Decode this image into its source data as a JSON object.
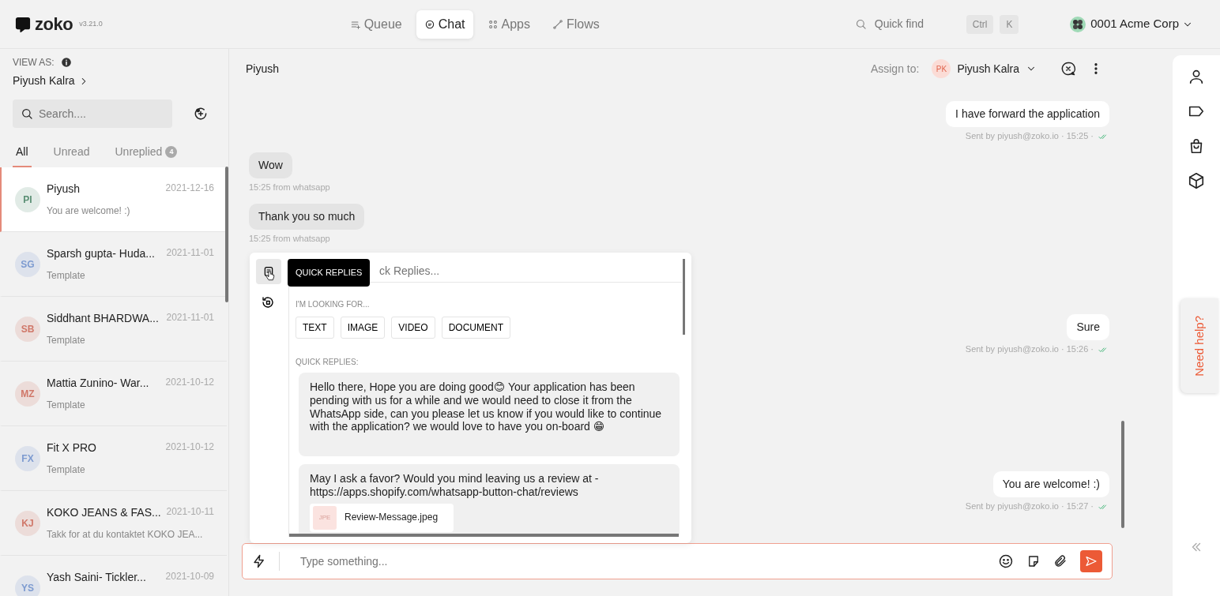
{
  "app": {
    "logo": "zoko",
    "version": "v3.21.0"
  },
  "nav": [
    {
      "label": "Queue",
      "selected": false
    },
    {
      "label": "Chat",
      "selected": true
    },
    {
      "label": "Apps",
      "selected": false
    },
    {
      "label": "Flows",
      "selected": false
    }
  ],
  "quick_find": {
    "placeholder": "Quick find",
    "keys": [
      "Ctrl",
      "K"
    ]
  },
  "account": {
    "name": "0001 Acme Corp"
  },
  "sidebar": {
    "view_as_label": "VIEW AS:",
    "view_as_user": "Piyush Kalra",
    "search_placeholder": "Search....",
    "tabs": [
      {
        "label": "All",
        "selected": true
      },
      {
        "label": "Unread",
        "selected": false
      },
      {
        "label": "Unreplied",
        "count": "4",
        "selected": false
      }
    ],
    "chats": [
      {
        "initials": "PI",
        "name": "Piyush",
        "date": "2021-12-16",
        "preview": "You are welcome! :)",
        "color": "#5a8f74",
        "selected": true
      },
      {
        "initials": "SG",
        "name": "Sparsh gupta- Huda...",
        "date": "2021-11-01",
        "preview": "Template",
        "color": "#7d9bd0",
        "selected": false
      },
      {
        "initials": "SB",
        "name": "Siddhant BHARDWA...",
        "date": "2021-11-01",
        "preview": "Template",
        "color": "#d0786a",
        "selected": false
      },
      {
        "initials": "MZ",
        "name": "Mattia Zunino- War...",
        "date": "2021-10-12",
        "preview": "Template",
        "color": "#d0786a",
        "selected": false
      },
      {
        "initials": "FX",
        "name": "Fit X PRO",
        "date": "2021-10-12",
        "preview": "Template",
        "color": "#7d9bd0",
        "selected": false
      },
      {
        "initials": "KJ",
        "name": "KOKO JEANS & FAS...",
        "date": "2021-10-11",
        "preview": "Takk for at du kontaktet KOKO JEA...",
        "color": "#d0786a",
        "selected": false
      },
      {
        "initials": "YS",
        "name": "Yash Saini- Tickler...",
        "date": "2021-10-09",
        "color": "#7d9bd0",
        "selected": false
      }
    ]
  },
  "chat": {
    "title": "Piyush",
    "assign_label": "Assign to:",
    "assignee": {
      "initials": "PK",
      "name": "Piyush Kalra"
    },
    "messages": [
      {
        "kind": "outgoing",
        "text": "I have forward the application",
        "meta": "Sent by piyush@zoko.io · 15:25 ·",
        "read": true
      },
      {
        "kind": "incoming",
        "text": "Wow",
        "meta": "15:25 from whatsapp"
      },
      {
        "kind": "incoming",
        "text": "Thank you so much",
        "meta": "15:25 from whatsapp"
      },
      {
        "kind": "outgoing",
        "text": "Sure",
        "meta": "Sent by piyush@zoko.io · 15:26 ·",
        "read": true
      },
      {
        "kind": "outgoing",
        "text": "You are welcome! :)",
        "meta": "Sent by piyush@zoko.io · 15:27 ·",
        "read": true
      }
    ],
    "composer_placeholder": "Type something..."
  },
  "quick_replies": {
    "tooltip": "QUICK REPLIES",
    "search_placeholder": "ck Replies...",
    "filter_label": "I'M LOOKING FOR...",
    "filters": [
      "TEXT",
      "IMAGE",
      "VIDEO",
      "DOCUMENT"
    ],
    "section_label": "QUICK REPLIES:",
    "replies": [
      {
        "text": "Hello there, Hope you are doing good😊 Your application has been pending with us for a while and we would need to close it from the WhatsApp side, can you please let us know if you would like to continue with the application? we would love to have you on-board 😁"
      },
      {
        "text": "May I ask a favor? Would you mind leaving us a review at - https://apps.shopify.com/whatsapp-button-chat/reviews",
        "attachment": {
          "type": "JPE",
          "name": "Review-Message.jpeg"
        }
      }
    ]
  },
  "help_tab": "Need help?"
}
